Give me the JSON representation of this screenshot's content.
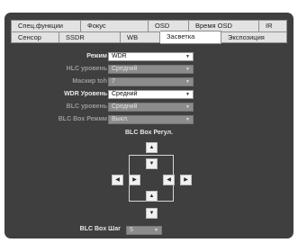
{
  "tabs": {
    "row1": [
      "Спец.функции",
      "Фокус",
      "OSD",
      "Время OSD",
      "IR"
    ],
    "row2": [
      "Сенсор",
      "SSDR",
      "WB",
      "Засветка",
      "Экспозиция"
    ]
  },
  "form": {
    "mode": {
      "label": "Режим",
      "value": "WDR"
    },
    "hlc_level": {
      "label": "HLC уровень",
      "value": "Средний"
    },
    "mask_toh": {
      "label": "Маскир toh",
      "value": "7"
    },
    "wdr_level": {
      "label": "WDR Уровень",
      "value": "Средний"
    },
    "blc_level": {
      "label": "BLC уровень",
      "value": "Средний"
    },
    "blc_box_mode": {
      "label": "BLC Box Режим",
      "value": "Выкл."
    }
  },
  "blc_box": {
    "title": "BLC Box Регул.",
    "icons": {
      "up": "▲",
      "down": "▼",
      "left": "◀",
      "right": "▶"
    }
  },
  "blc_step": {
    "label": "BLC Box Шаг",
    "value": "5"
  },
  "arrow_glyph": "▼"
}
